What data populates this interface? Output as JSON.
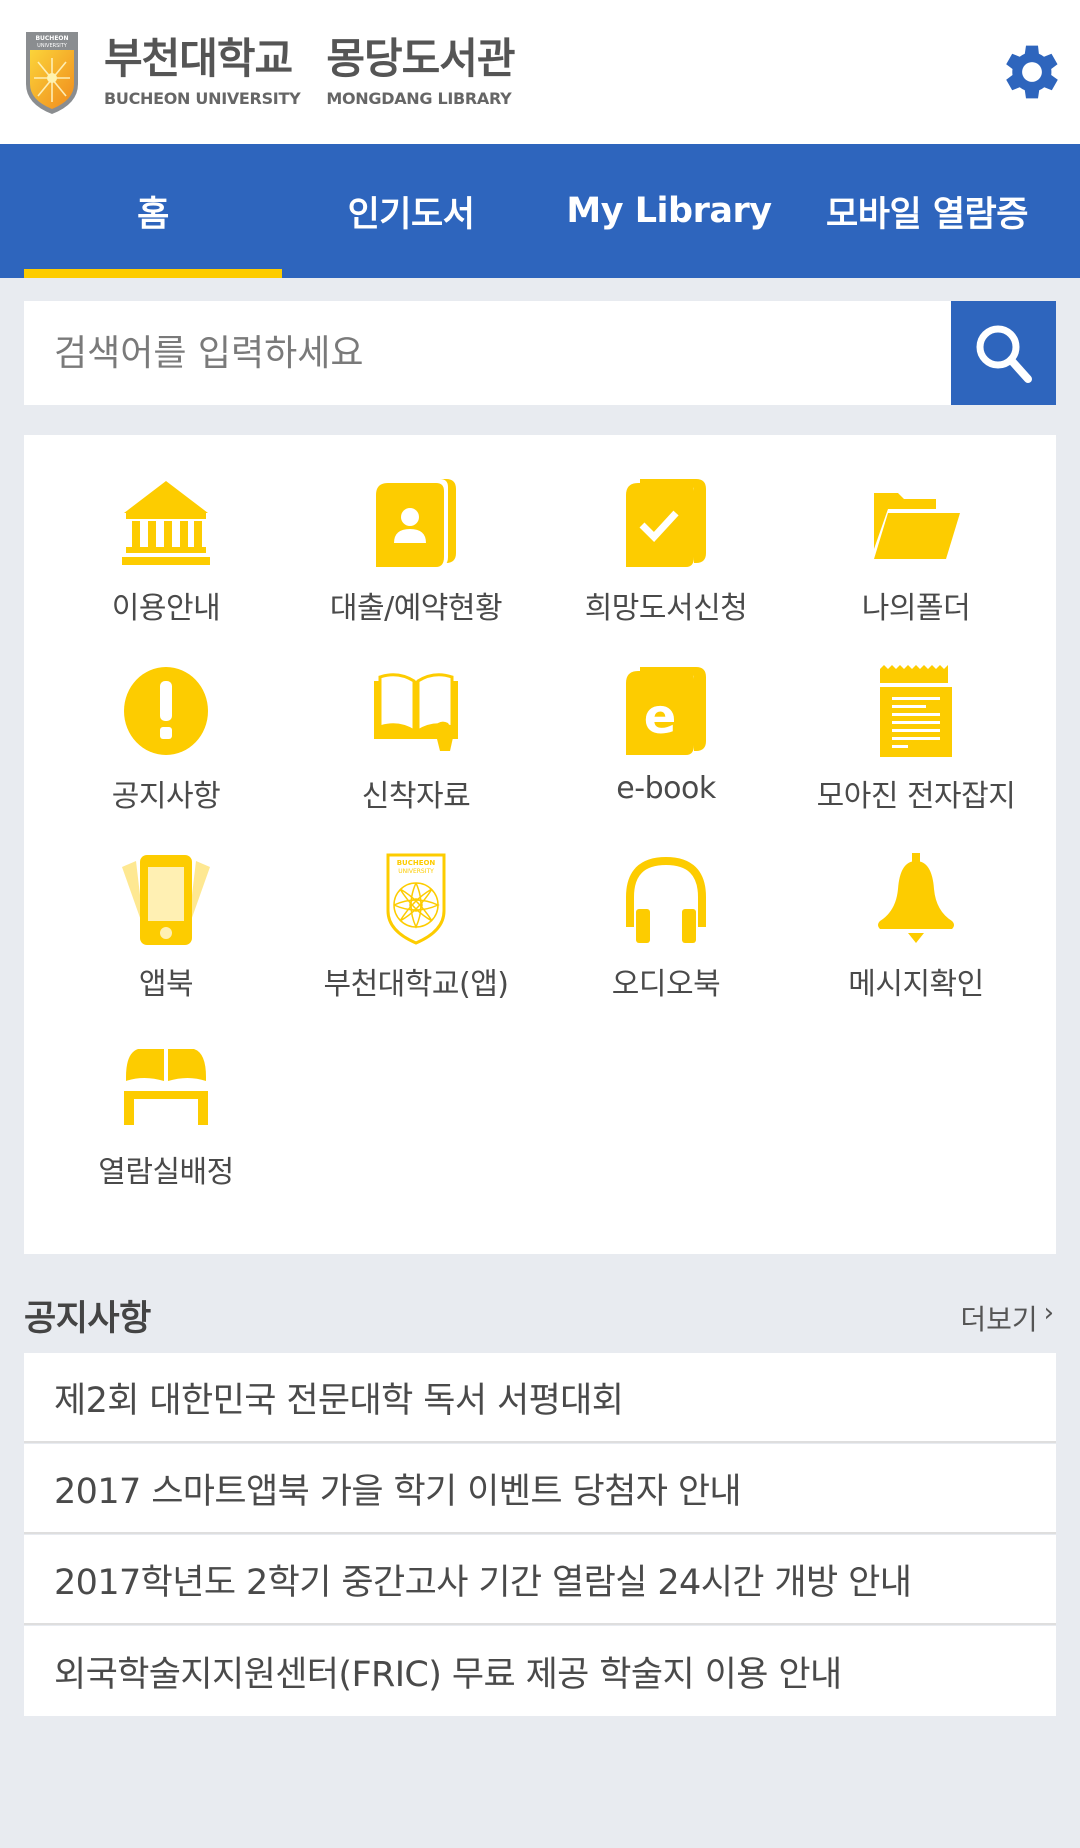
{
  "header": {
    "logo_ko_1": "부천대학교",
    "logo_en_1": "BUCHEON UNIVERSITY",
    "logo_ko_2": "몽당도서관",
    "logo_en_2": "MONGDANG LIBRARY",
    "settings_icon": "gear-icon"
  },
  "colors": {
    "brand_blue": "#2e65bd",
    "accent_yellow": "#fdcc00",
    "background": "#e8ebf0"
  },
  "tabs": [
    {
      "label": "홈",
      "active": true
    },
    {
      "label": "인기도서",
      "active": false
    },
    {
      "label": "My Library",
      "active": false
    },
    {
      "label": "모바일 열람증",
      "active": false
    }
  ],
  "search": {
    "placeholder": "검색어를 입력하세요",
    "value": "",
    "button_icon": "search-icon"
  },
  "menu": [
    {
      "label": "이용안내",
      "icon": "library-building-icon"
    },
    {
      "label": "대출/예약현황",
      "icon": "user-book-icon"
    },
    {
      "label": "희망도서신청",
      "icon": "book-check-icon"
    },
    {
      "label": "나의폴더",
      "icon": "folder-icon"
    },
    {
      "label": "공지사항",
      "icon": "exclamation-icon"
    },
    {
      "label": "신착자료",
      "icon": "open-book-icon"
    },
    {
      "label": "e-book",
      "icon": "ebook-icon"
    },
    {
      "label": "모아진 전자잡지",
      "icon": "magazine-icon"
    },
    {
      "label": "앱북",
      "icon": "phone-icon"
    },
    {
      "label": "부천대학교(앱)",
      "icon": "university-emblem-icon"
    },
    {
      "label": "오디오북",
      "icon": "headphones-icon"
    },
    {
      "label": "메시지확인",
      "icon": "bell-icon"
    },
    {
      "label": "열람실배정",
      "icon": "reading-room-icon"
    }
  ],
  "notices": {
    "title": "공지사항",
    "more_label": "더보기",
    "items": [
      "제2회 대한민국 전문대학 독서 서평대회",
      "2017 스마트앱북 가을 학기 이벤트 당첨자 안내",
      "2017학년도 2학기 중간고사 기간 열람실 24시간 개방 안내",
      "외국학술지지원센터(FRIC) 무료 제공 학술지 이용 안내"
    ]
  }
}
